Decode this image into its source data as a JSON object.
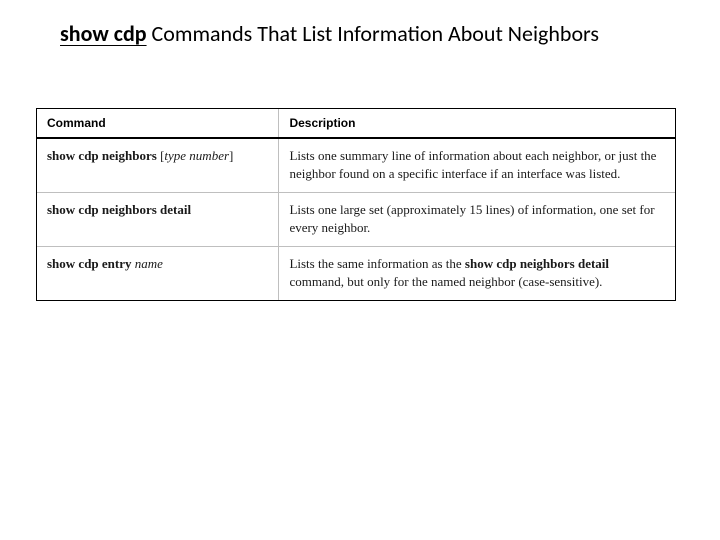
{
  "title": {
    "bold_underlined": "show cdp",
    "rest": " Commands That List Information About Neighbors"
  },
  "table": {
    "headers": {
      "command": "Command",
      "description": "Description"
    },
    "rows": [
      {
        "cmd_bold": "show cdp neighbors",
        "cmd_open": " [",
        "cmd_arg": "type number",
        "cmd_close": "]",
        "desc": "Lists one summary line of information about each neighbor, or just the neighbor found on a specific interface if an interface was listed."
      },
      {
        "cmd_bold": "show cdp neighbors detail",
        "cmd_open": "",
        "cmd_arg": "",
        "cmd_close": "",
        "desc": "Lists one large set (approximately 15 lines) of information, one set for every neighbor."
      },
      {
        "cmd_bold": "show cdp entry",
        "cmd_open": " ",
        "cmd_arg": "name",
        "cmd_close": "",
        "desc_pre": "Lists the same information as the ",
        "desc_bold": "show cdp neighbors detail",
        "desc_post": " command, but only for the named neighbor (case-sensitive)."
      }
    ]
  }
}
